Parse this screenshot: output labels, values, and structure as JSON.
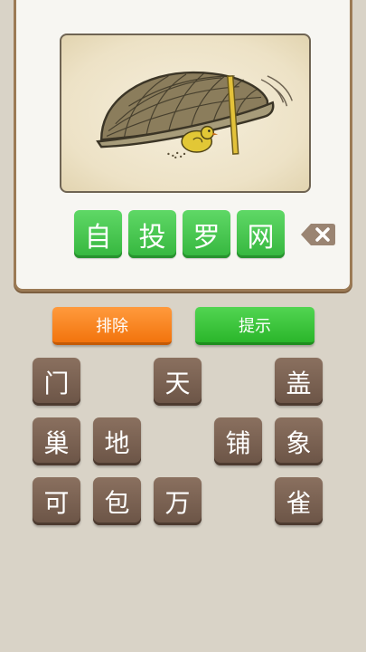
{
  "puzzle": {
    "image_icon": "hat-trap-bird-illustration"
  },
  "answer": {
    "slots": [
      "自",
      "投",
      "罗",
      "网"
    ]
  },
  "controls": {
    "delete_icon": "backspace-icon",
    "remove_label": "排除",
    "hint_label": "提示"
  },
  "letters": {
    "rows": [
      [
        "门",
        "",
        "天",
        "",
        "盖"
      ],
      [
        "巢",
        "地",
        "",
        "铺",
        "象"
      ],
      [
        "可",
        "包",
        "万",
        "",
        "雀"
      ]
    ]
  },
  "colors": {
    "answer_tile": "#3fbf47",
    "letter_tile": "#7a6253",
    "remove_button": "#f47b16",
    "hint_button": "#37bd37",
    "background": "#d9d3c7"
  }
}
